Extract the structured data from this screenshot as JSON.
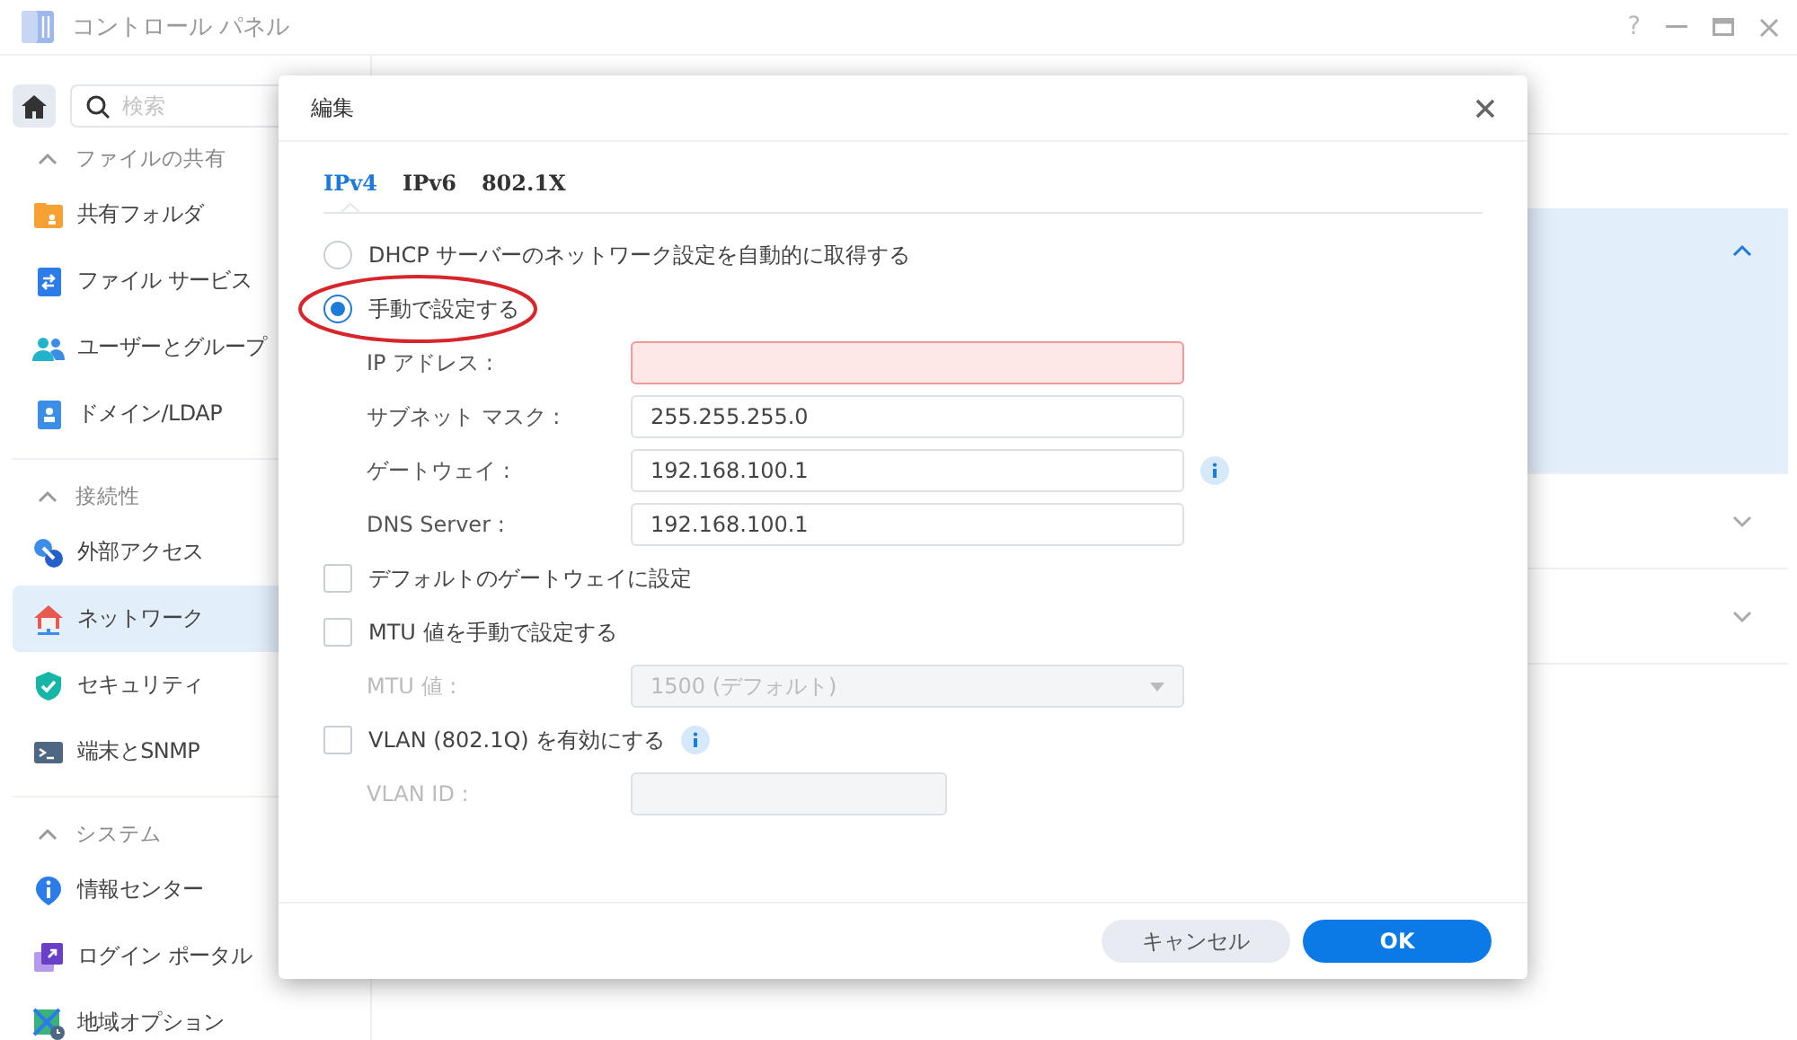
{
  "window": {
    "title": "コントロール パネル",
    "help": "?"
  },
  "sidebar": {
    "search": {
      "placeholder": "検索"
    },
    "groups": [
      {
        "label": "ファイルの共有",
        "expanded": true,
        "items": [
          {
            "label": "共有フォルダ",
            "selected": false
          },
          {
            "label": "ファイル サービス",
            "selected": false
          },
          {
            "label": "ユーザーとグループ",
            "selected": false
          },
          {
            "label": "ドメイン/LDAP",
            "selected": false
          }
        ]
      },
      {
        "label": "接続性",
        "expanded": true,
        "items": [
          {
            "label": "外部アクセス",
            "selected": false
          },
          {
            "label": "ネットワーク",
            "selected": true
          },
          {
            "label": "セキュリティ",
            "selected": false
          },
          {
            "label": "端末とSNMP",
            "selected": false
          }
        ]
      },
      {
        "label": "システム",
        "expanded": true,
        "items": [
          {
            "label": "情報センター",
            "selected": false
          },
          {
            "label": "ログイン ポータル",
            "selected": false
          },
          {
            "label": "地域オプション",
            "selected": false
          }
        ]
      }
    ]
  },
  "panel": {
    "sections": [
      {
        "expanded": true
      },
      {
        "expanded": false
      },
      {
        "expanded": false
      }
    ]
  },
  "dialog": {
    "title": "編集",
    "tabs": [
      {
        "label": "IPv4",
        "selected": true
      },
      {
        "label": "IPv6",
        "selected": false
      },
      {
        "label": "802.1X",
        "selected": false
      }
    ],
    "rows": [
      {
        "kind": "radio",
        "label": "DHCP サーバーのネットワーク設定を自動的に取得する",
        "selected": false,
        "highlighted": false
      },
      {
        "kind": "radio",
        "label": "手動で設定する",
        "selected": true,
        "highlighted": true
      },
      {
        "kind": "field",
        "label": "IP アドレス :",
        "invalid": true,
        "disabled": false,
        "info": false
      },
      {
        "kind": "field",
        "label": "サブネット マスク :",
        "value": "255.255.255.0",
        "invalid": false,
        "disabled": false,
        "info": false
      },
      {
        "kind": "field",
        "label": "ゲートウェイ :",
        "value": "192.168.100.1",
        "invalid": false,
        "disabled": false,
        "info": true
      },
      {
        "kind": "field",
        "label": "DNS Server :",
        "value": "192.168.100.1",
        "invalid": false,
        "disabled": false,
        "info": false
      },
      {
        "kind": "checkbox",
        "label": "デフォルトのゲートウェイに設定",
        "checked": false,
        "info": false
      },
      {
        "kind": "checkbox",
        "label": "MTU 値を手動で設定する",
        "checked": false,
        "info": false
      },
      {
        "kind": "select",
        "label": "MTU 値 :",
        "value": "1500 (デフォルト)",
        "disabled": true
      },
      {
        "kind": "checkbox",
        "label": "VLAN (802.1Q) を有効にする",
        "checked": false,
        "info": true
      },
      {
        "kind": "short-field",
        "label": "VLAN ID :",
        "invalid": false,
        "disabled": true,
        "info": false
      }
    ],
    "buttons": [
      {
        "label": "キャンセル",
        "kind": "secondary"
      },
      {
        "label": "OK",
        "kind": "primary"
      }
    ]
  }
}
